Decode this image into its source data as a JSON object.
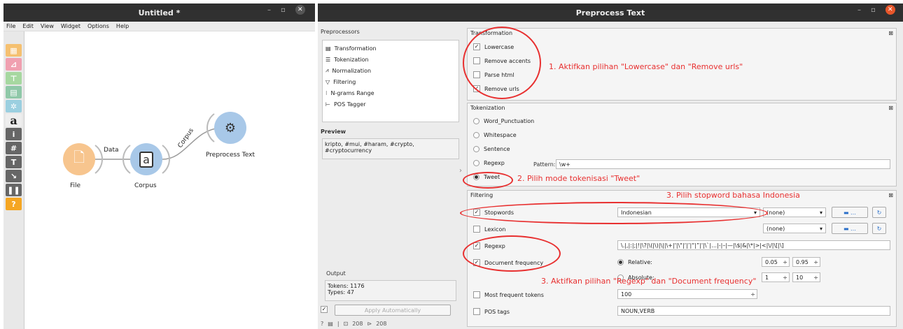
{
  "left_window": {
    "title": "Untitled *",
    "menu": [
      "File",
      "Edit",
      "View",
      "Widget",
      "Options",
      "Help"
    ],
    "nodes": {
      "file": "File",
      "corpus": "Corpus",
      "preprocess": "Preprocess Text"
    },
    "links": {
      "data": "Data",
      "corpus": "Corpus"
    }
  },
  "right_window": {
    "title": "Preprocess Text",
    "preprocessors_label": "Preprocessors",
    "preprocessors": [
      "Transformation",
      "Tokenization",
      "Normalization",
      "Filtering",
      "N-grams Range",
      "POS Tagger"
    ],
    "preview_label": "Preview",
    "preview_text": "kripto, #mui, #haram, #crypto, #cryptocurrency",
    "output_label": "Output",
    "tokens": "Tokens: 1176",
    "types": "Types: 47",
    "apply_label": "Apply Automatically",
    "status_in": "208",
    "status_out": "208"
  },
  "transformation": {
    "title": "Transformation",
    "items": [
      {
        "label": "Lowercase",
        "checked": true
      },
      {
        "label": "Remove accents",
        "checked": false
      },
      {
        "label": "Parse html",
        "checked": false
      },
      {
        "label": "Remove urls",
        "checked": true
      }
    ]
  },
  "tokenization": {
    "title": "Tokenization",
    "items": [
      "Word_Punctuation",
      "Whitespace",
      "Sentence",
      "Regexp",
      "Tweet"
    ],
    "selected": "Tweet",
    "pattern_label": "Pattern:",
    "pattern_value": "\\w+"
  },
  "filtering": {
    "title": "Filtering",
    "stopwords": "Stopwords",
    "stopwords_lang": "Indonesian",
    "stopwords_file": "(none)",
    "lexicon": "Lexicon",
    "lexicon_file": "(none)",
    "regexp": "Regexp",
    "regexp_value": "\\.|,|:|;|!|\\?|\\(|\\)|\\||\\+|'|\\\"|‘|’|“|”|'|\\`|…|-|–|—|\\$|&|\\*|>|<|\\/|\\[|\\]",
    "docfreq": "Document frequency",
    "relative": "Relative:",
    "rel_min": "0.05",
    "rel_max": "0.95",
    "absolute": "Absolute:",
    "abs_min": "1",
    "abs_max": "10",
    "most_frequent": "Most frequent tokens",
    "most_frequent_value": "100",
    "pos_tags": "POS tags",
    "pos_value": "NOUN,VERB"
  },
  "annotations": {
    "a1": "1. Aktifkan pilihan \"Lowercase\" dan \"Remove urls\"",
    "a2": "2. Pilih mode tokenisasi \"Tweet\"",
    "a3a": "3. Pilih stopword bahasa Indonesia",
    "a3b": "3. Aktifkan pilihan \"Regexp\" dan \"Document frequency\""
  },
  "colors": {
    "accent": "#e83030",
    "node_file": "#f7c58e",
    "node_corpus": "#a8c8e8",
    "close": "#e8562a"
  }
}
